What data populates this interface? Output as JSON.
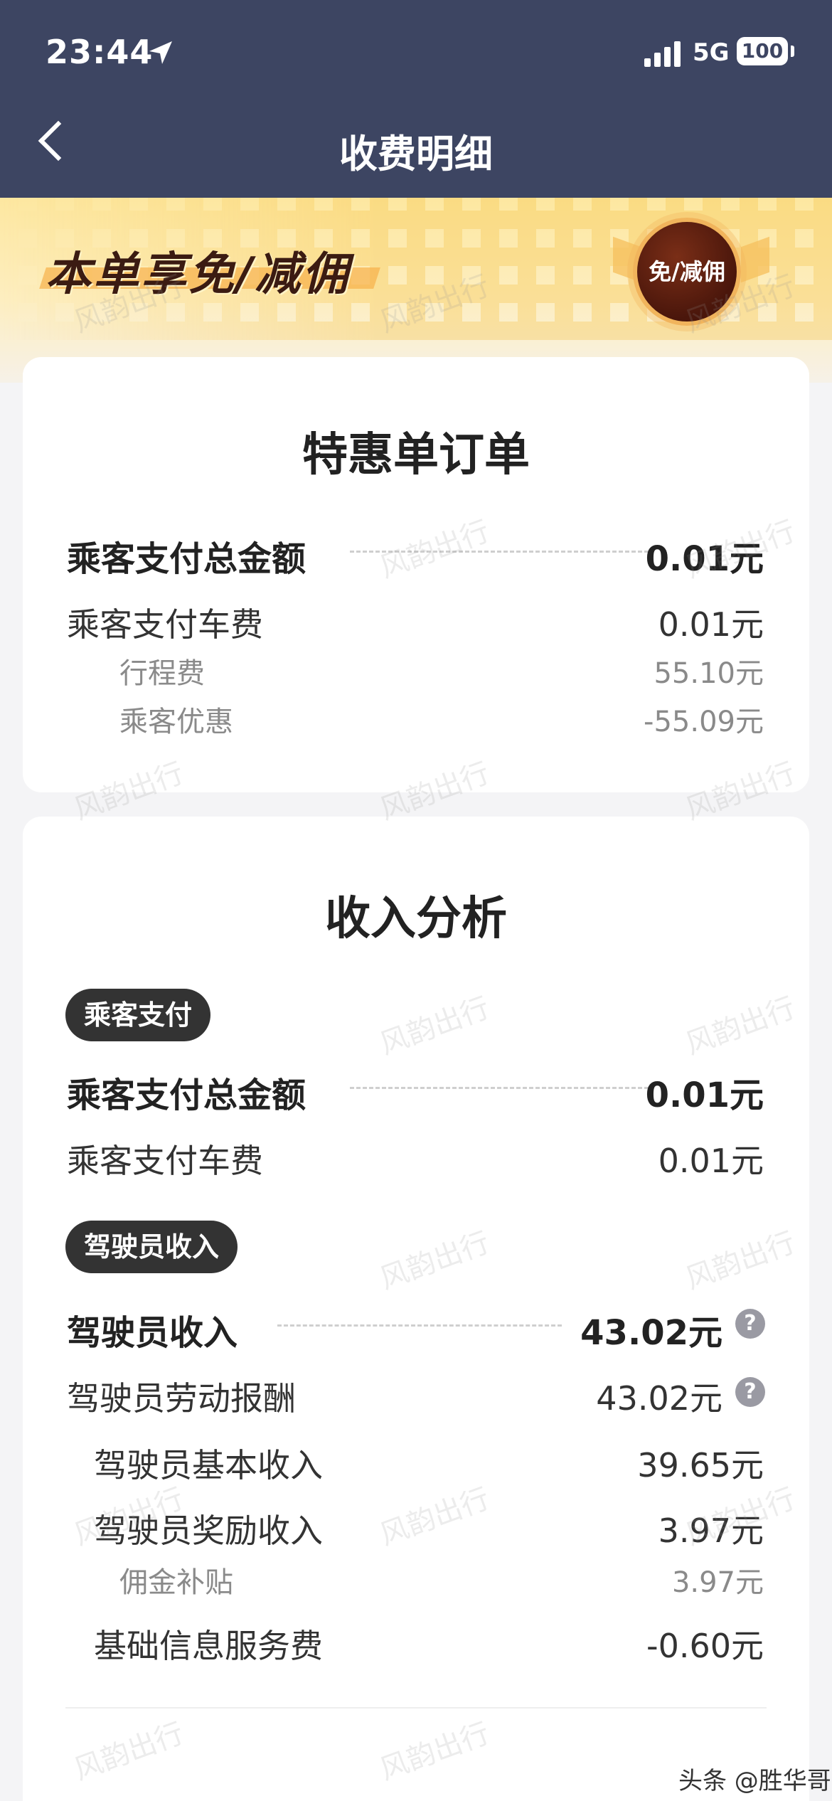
{
  "status_bar": {
    "time": "23:44",
    "network": "5G",
    "battery": "100"
  },
  "nav": {
    "title": "收费明细"
  },
  "banner": {
    "text": "本单享免/减佣",
    "badge": "免/减佣"
  },
  "order_card": {
    "title": "特惠单订单",
    "total_label": "乘客支付总金额",
    "total_value": "0.01元",
    "fare_label": "乘客支付车费",
    "fare_value": "0.01元",
    "trip_label": "行程费",
    "trip_value": "55.10元",
    "discount_label": "乘客优惠",
    "discount_value": "-55.09元"
  },
  "income_card": {
    "title": "收入分析",
    "passenger_tag": "乘客支付",
    "total_label": "乘客支付总金额",
    "total_value": "0.01元",
    "fare_label": "乘客支付车费",
    "fare_value": "0.01元",
    "driver_tag": "驾驶员收入",
    "driver_income_label": "驾驶员收入",
    "driver_income_value": "43.02元",
    "labor_label": "驾驶员劳动报酬",
    "labor_value": "43.02元",
    "base_label": "驾驶员基本收入",
    "base_value": "39.65元",
    "bonus_label": "驾驶员奖励收入",
    "bonus_value": "3.97元",
    "commission_label": "佣金补贴",
    "commission_value": "3.97元",
    "service_fee_label": "基础信息服务费",
    "service_fee_value": "-0.60元"
  },
  "watermark": "风韵出行",
  "caption": "头条 @胜华哥"
}
